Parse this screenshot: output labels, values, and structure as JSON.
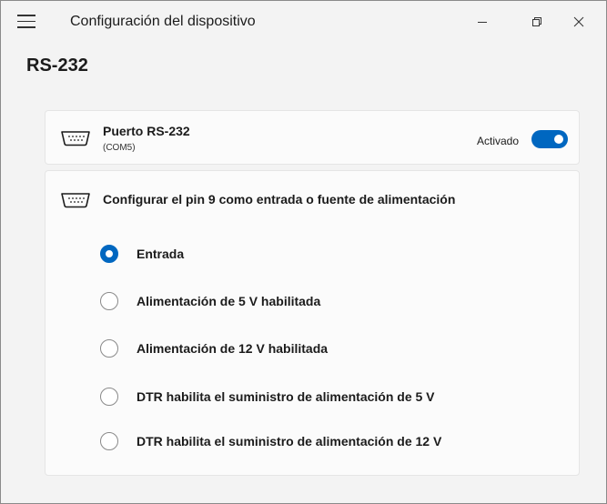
{
  "window": {
    "title": "Configuración del dispositivo"
  },
  "page": {
    "title": "RS-232"
  },
  "port_card": {
    "name": "Puerto RS-232",
    "sub": "(COM5)",
    "toggle_label": "Activado",
    "toggle_on": true,
    "icon": "serial-port-icon"
  },
  "pin_card": {
    "heading": "Configurar el pin 9 como entrada o fuente de alimentación",
    "icon": "serial-port-icon",
    "options": [
      {
        "label": "Entrada",
        "selected": true
      },
      {
        "label": "Alimentación de 5 V habilitada",
        "selected": false
      },
      {
        "label": "Alimentación de 12 V habilitada",
        "selected": false
      },
      {
        "label": "DTR habilita el suministro de alimentación de 5 V",
        "selected": false
      },
      {
        "label": "DTR habilita el suministro de alimentación de 12 V",
        "selected": false
      }
    ]
  },
  "colors": {
    "accent": "#0067c0",
    "background": "#f3f3f3",
    "card": "#fbfbfb"
  }
}
